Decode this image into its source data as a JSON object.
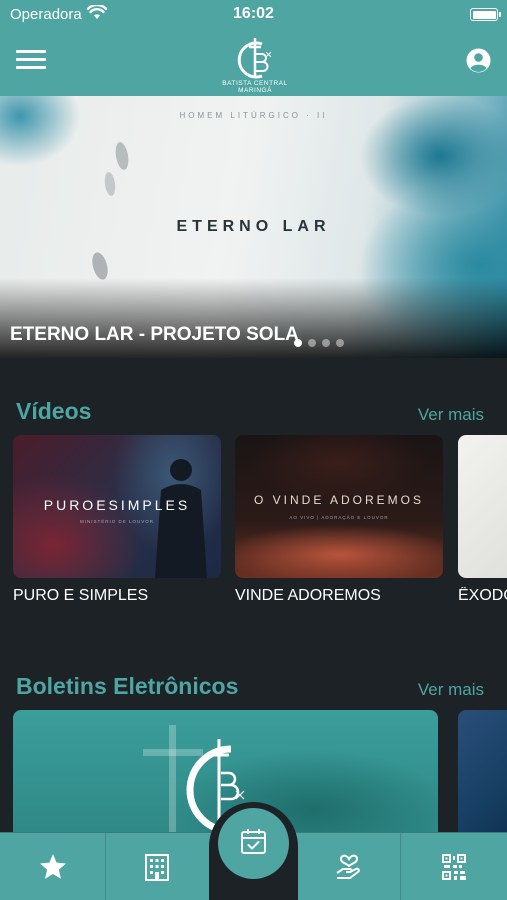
{
  "status_bar": {
    "carrier": "Operadora",
    "time": "16:02"
  },
  "header": {
    "logo_caption": "BATISTA CENTRAL MARINGÁ",
    "menu_icon": "hamburger-menu-icon",
    "profile_icon": "user-circle-icon"
  },
  "banner": {
    "kicker": "HOMEM LITÚRGICO · II",
    "art_title": "ETERNO LAR",
    "caption": "ETERNO LAR - PROJETO SOLA",
    "slides_count": 4,
    "active_slide": 1
  },
  "videos": {
    "title": "Vídeos",
    "see_more": "Ver mais",
    "items": [
      {
        "label": "PURO E SIMPLES",
        "art": "PUROESIMPLES",
        "art_sub": "MINISTÉRIO DE LOUVOR"
      },
      {
        "label": "VINDE ADOREMOS",
        "art": "O VINDE ADOREMOS",
        "art_sub": "AO VIVO | ADORAÇÃO E LOUVOR"
      },
      {
        "label": "ÊXODO"
      }
    ]
  },
  "bulletins": {
    "title": "Boletins Eletrônicos",
    "see_more": "Ver mais"
  },
  "tabbar": {
    "items": [
      "star-icon",
      "building-icon",
      "calendar-check-icon",
      "heart-hand-icon",
      "qr-code-icon"
    ]
  },
  "colors": {
    "brand": "#4ea5a2",
    "background": "#1d2226",
    "text": "#ffffff"
  }
}
